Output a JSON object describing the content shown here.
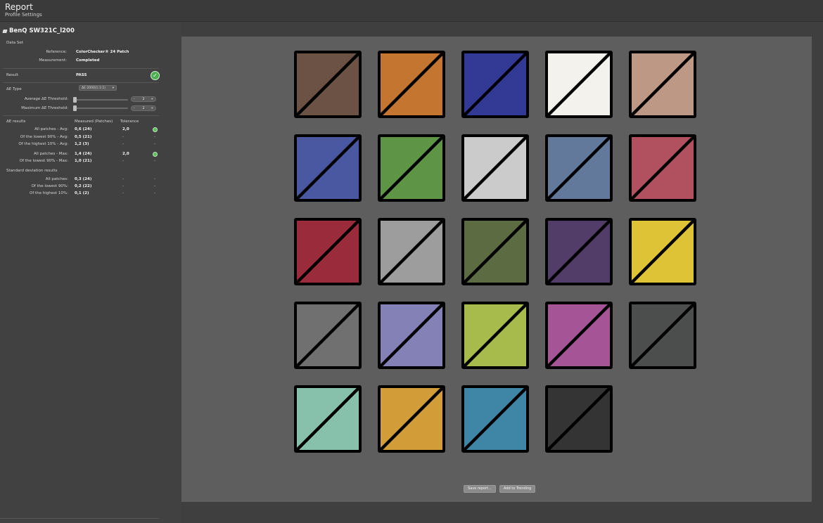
{
  "header": {
    "title": "Report",
    "subtitle": "Profile Settings"
  },
  "device": {
    "name": "BenQ SW321C_l200"
  },
  "data_set": {
    "heading": "Data Set",
    "reference_label": "Reference:",
    "reference_value": "ColorChecker® 24 Patch",
    "measurement_label": "Measurement:",
    "measurement_value": "Completed"
  },
  "result": {
    "label": "Result",
    "value": "PASS",
    "check": "✓"
  },
  "delta_e_type": {
    "label": "ΔE Type",
    "selected": "ΔE 2000(1:1:1)",
    "avg_threshold_label": "Average  ΔE Threshold:",
    "avg_threshold_value": "2",
    "max_threshold_label": "Maximum ΔE Threshold:",
    "max_threshold_value": "2",
    "minus": "-",
    "plus": "+"
  },
  "de_results": {
    "heading": "ΔE results",
    "col_measured": "Measured (Patches)",
    "col_tolerance": "Tolerance",
    "rows": [
      {
        "label": "All patches - Avg:",
        "measured": "0,6  (24)",
        "tolerance": "2,0",
        "status": "check"
      },
      {
        "label": "Of the lowest 90% - Avg:",
        "measured": "0,5  (21)",
        "tolerance": "-",
        "status": "-"
      },
      {
        "label": "Of the highest 10% - Avg:",
        "measured": "1,2  (3)",
        "tolerance": "-",
        "status": "-"
      },
      {
        "label": "All patches - Max:",
        "measured": "1,4  (24)",
        "tolerance": "2,0",
        "status": "check"
      },
      {
        "label": "Of the lowest 90% - Max:",
        "measured": "1,0  (21)",
        "tolerance": "-",
        "status": "-"
      }
    ]
  },
  "std_results": {
    "heading": "Standard deviation results",
    "rows": [
      {
        "label": "All patches:",
        "measured": "0,3  (24)",
        "tolerance": "-",
        "status": "-"
      },
      {
        "label": "Of the lowest 90%:",
        "measured": "0,2  (22)",
        "tolerance": "-",
        "status": "-"
      },
      {
        "label": "Of the highest 10%:",
        "measured": "0,1  (2)",
        "tolerance": "-",
        "status": "-"
      }
    ]
  },
  "patches": [
    {
      "ref": "#6b5244",
      "meas": "#6b5244"
    },
    {
      "ref": "#c47530",
      "meas": "#c47530"
    },
    {
      "ref": "#333a96",
      "meas": "#333a96"
    },
    {
      "ref": "#f4f2ec",
      "meas": "#f4f2ec"
    },
    {
      "ref": "#bd9985",
      "meas": "#bd9985"
    },
    {
      "ref": "#4a58a2",
      "meas": "#4a58a2"
    },
    {
      "ref": "#5e9445",
      "meas": "#5e9445"
    },
    {
      "ref": "#cbcbcb",
      "meas": "#cbcbcb"
    },
    {
      "ref": "#63799c",
      "meas": "#63799c"
    },
    {
      "ref": "#b15160",
      "meas": "#b15160"
    },
    {
      "ref": "#9a2b3a",
      "meas": "#9a2b3a"
    },
    {
      "ref": "#9d9d9d",
      "meas": "#9d9d9d"
    },
    {
      "ref": "#5c6b42",
      "meas": "#5c6b42"
    },
    {
      "ref": "#523d69",
      "meas": "#523d69"
    },
    {
      "ref": "#dec337",
      "meas": "#dec337"
    },
    {
      "ref": "#707070",
      "meas": "#707070"
    },
    {
      "ref": "#8381b6",
      "meas": "#8381b6"
    },
    {
      "ref": "#a6bb4b",
      "meas": "#a6bb4b"
    },
    {
      "ref": "#a55596",
      "meas": "#a55596"
    },
    {
      "ref": "#4c4e4d",
      "meas": "#4c4e4d"
    },
    {
      "ref": "#87c1ab",
      "meas": "#87c1ab"
    },
    {
      "ref": "#d29c38",
      "meas": "#d29c38"
    },
    {
      "ref": "#3f85a6",
      "meas": "#3f85a6"
    },
    {
      "ref": "#343434",
      "meas": "#343434"
    }
  ],
  "buttons": {
    "save": "Save report...",
    "trending": "Add to Trending"
  }
}
